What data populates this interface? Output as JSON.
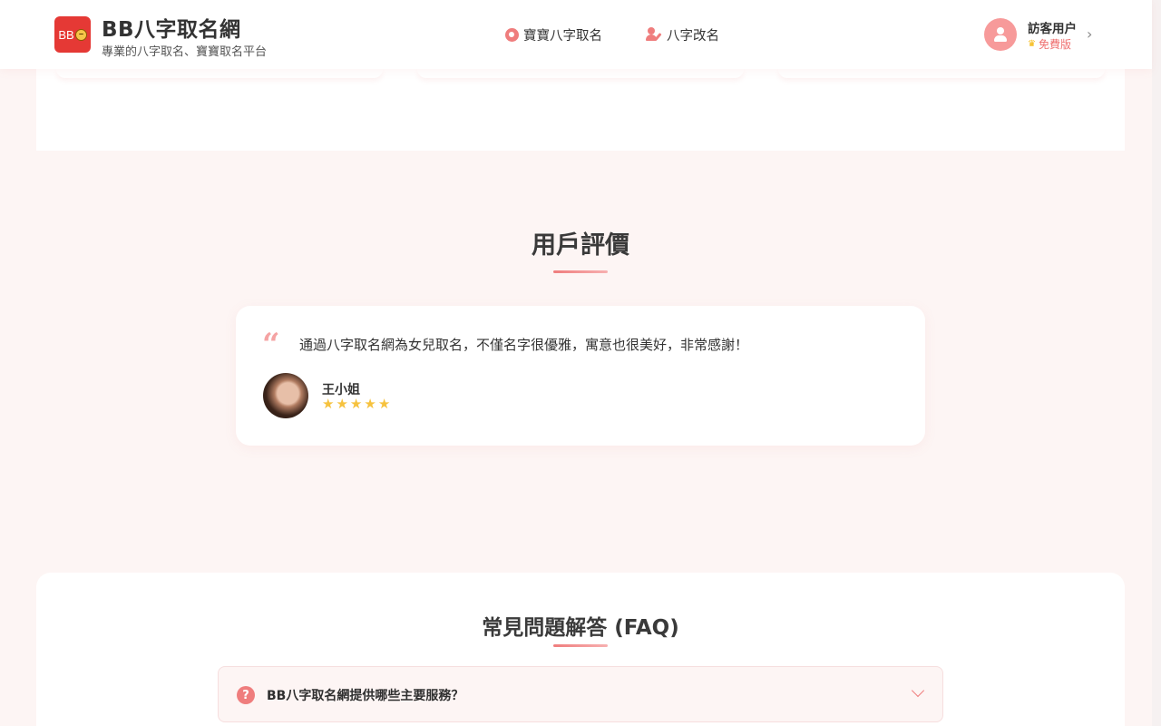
{
  "header": {
    "logo_text": "BB",
    "brand_title": "BB八字取名網",
    "brand_subtitle": "專業的八字取名、寶寶取名平台",
    "nav": [
      {
        "label": "寶寶八字取名",
        "icon": "baby-icon"
      },
      {
        "label": "八字改名",
        "icon": "user-edit-icon"
      }
    ],
    "user": {
      "name": "訪客用户",
      "plan": "免費版",
      "plan_icon": "crown-icon"
    }
  },
  "reviews": {
    "title": "用戶評價",
    "items": [
      {
        "text": "通過八字取名網為女兒取名，不僅名字很優雅，寓意也很美好，非常感謝！",
        "name": "王小姐",
        "rating": 5
      }
    ]
  },
  "faq": {
    "title": "常見問題解答 (FAQ)",
    "items": [
      {
        "question": "BB八字取名網提供哪些主要服務？",
        "expanded": false
      }
    ]
  },
  "colors": {
    "accent": "#ef7d7d",
    "logo_bg": "#e53935",
    "star": "#f6c23e",
    "page_bg": "#fdf5f4"
  }
}
